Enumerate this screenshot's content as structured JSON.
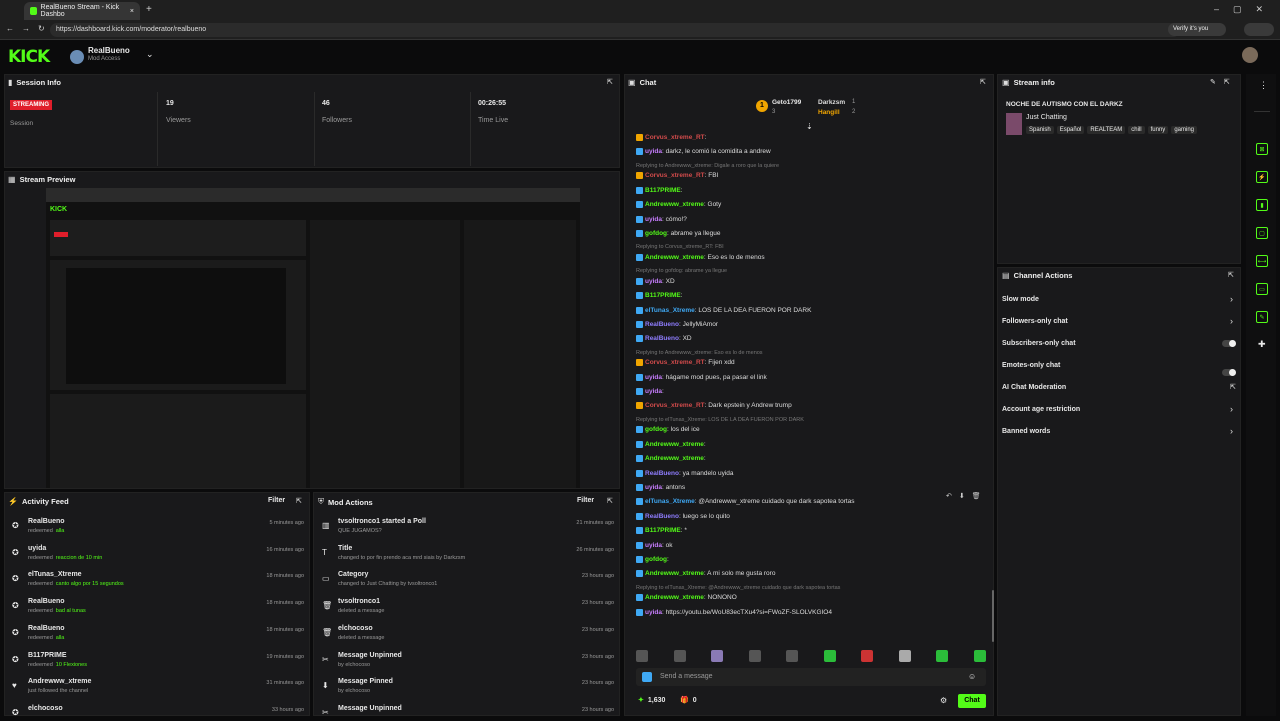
{
  "browser": {
    "tab_title": "RealBueno Stream - Kick Dashbo",
    "url": "https://dashboard.kick.com/moderator/realbueno",
    "verify": "Verify it's you"
  },
  "header": {
    "logo": "KICK",
    "channel": "RealBueno",
    "access": "Mod Access"
  },
  "session": {
    "title": "Session Info",
    "status": "STREAMING",
    "status_label": "Session",
    "viewers": "19",
    "viewers_label": "Viewers",
    "followers": "46",
    "followers_label": "Followers",
    "time": "00:26:55",
    "time_label": "Time Live"
  },
  "preview": {
    "title": "Stream Preview"
  },
  "activity": {
    "title": "Activity Feed",
    "filter": "Filter",
    "items": [
      {
        "user": "RealBueno",
        "action": "redeemed",
        "target": "alla",
        "time": "5 minutes ago"
      },
      {
        "user": "uyida",
        "action": "redeemed",
        "target": "reaccion de 10 min",
        "time": "16 minutes ago"
      },
      {
        "user": "elTunas_Xtreme",
        "action": "redeemed",
        "target": "canto algo por 15 segundos",
        "time": "18 minutes ago"
      },
      {
        "user": "RealBueno",
        "action": "redeemed",
        "target": "bad al tunas",
        "time": "18 minutes ago"
      },
      {
        "user": "RealBueno",
        "action": "redeemed",
        "target": "alla",
        "time": "18 minutes ago"
      },
      {
        "user": "B117PRIME",
        "action": "redeemed",
        "target": "10 Flexiones",
        "time": "19 minutes ago"
      },
      {
        "user": "Andrewww_xtreme",
        "action": "just followed the channel",
        "target": "",
        "time": "31 minutes ago"
      },
      {
        "user": "elchocoso",
        "action": "",
        "target": "",
        "time": "33 hours ago"
      }
    ]
  },
  "mod": {
    "title": "Mod Actions",
    "filter": "Filter",
    "items": [
      {
        "title": "tvsoltronco1 started a Poll",
        "sub": "QUE JUGAMOS?",
        "time": "21 minutes ago",
        "icon": "poll-icon"
      },
      {
        "title": "Title",
        "sub": "changed to por fin prendo aca mrd siais by Darkzsm",
        "time": "26 minutes ago",
        "icon": "title-icon"
      },
      {
        "title": "Category",
        "sub": "changed to Just Chatting by tvsoltronco1",
        "time": "23 hours ago",
        "icon": "category-icon"
      },
      {
        "title": "tvsoltronco1",
        "sub": "deleted a message",
        "time": "23 hours ago",
        "icon": "trash-icon"
      },
      {
        "title": "elchocoso",
        "sub": "deleted a message",
        "time": "23 hours ago",
        "icon": "trash-icon"
      },
      {
        "title": "Message Unpinned",
        "sub": "by elchocoso",
        "time": "23 hours ago",
        "icon": "unpin-icon"
      },
      {
        "title": "Message Pinned",
        "sub": "by elchocoso",
        "time": "23 hours ago",
        "icon": "pin-icon"
      },
      {
        "title": "Message Unpinned",
        "sub": "",
        "time": "23 hours ago",
        "icon": "unpin-icon"
      }
    ]
  },
  "chat": {
    "title": "Chat",
    "top": [
      {
        "name": "Geto1799",
        "count": "3"
      },
      {
        "name": "Darkzsm",
        "count": "1"
      },
      {
        "name": "Hangill",
        "count": "2"
      }
    ],
    "lines": [
      {
        "type": "msg",
        "user": "Corvus_xtreme_RT",
        "color": "#d14b4b",
        "text": ""
      },
      {
        "type": "msg",
        "user": "uyida",
        "color": "#c77dff",
        "text": "darkz, le comió la comidita a andrew"
      },
      {
        "type": "reply",
        "text": "Replying to Andrewww_xtreme: Digale a roro que la quiere"
      },
      {
        "type": "msg",
        "user": "Corvus_xtreme_RT",
        "color": "#d14b4b",
        "text": "FBI"
      },
      {
        "type": "msg",
        "user": "B117PRIME",
        "color": "#53fc18",
        "text": ""
      },
      {
        "type": "msg",
        "user": "Andrewww_xtreme",
        "color": "#53fc18",
        "text": "Goty"
      },
      {
        "type": "msg",
        "user": "uyida",
        "color": "#c77dff",
        "text": "cómo!?"
      },
      {
        "type": "msg",
        "user": "gofdog",
        "color": "#53fc18",
        "text": "abrame ya llegue"
      },
      {
        "type": "reply",
        "text": "Replying to Corvus_xtreme_RT: FBI"
      },
      {
        "type": "msg",
        "user": "Andrewww_xtreme",
        "color": "#53fc18",
        "text": "Eso es lo de menos"
      },
      {
        "type": "reply",
        "text": "Replying to gofdog: abrame ya llegue"
      },
      {
        "type": "msg",
        "user": "uyida",
        "color": "#c77dff",
        "text": "XD"
      },
      {
        "type": "msg",
        "user": "B117PRIME",
        "color": "#53fc18",
        "text": ""
      },
      {
        "type": "msg",
        "user": "elTunas_Xtreme",
        "color": "#3fa9f5",
        "text": "LOS DE LA DEA FUERON POR DARK"
      },
      {
        "type": "msg",
        "user": "RealBueno",
        "color": "#8f7dff",
        "text": "JellyMiAmor"
      },
      {
        "type": "msg",
        "user": "RealBueno",
        "color": "#8f7dff",
        "text": "XD"
      },
      {
        "type": "reply",
        "text": "Replying to Andrewww_xtreme: Eso es lo de menos"
      },
      {
        "type": "msg",
        "user": "Corvus_xtreme_RT",
        "color": "#d14b4b",
        "text": "Fijen xdd"
      },
      {
        "type": "msg",
        "user": "uyida",
        "color": "#c77dff",
        "text": "hágame mod pues, pa pasar el link"
      },
      {
        "type": "msg",
        "user": "uyida",
        "color": "#c77dff",
        "text": ""
      },
      {
        "type": "msg",
        "user": "Corvus_xtreme_RT",
        "color": "#d14b4b",
        "text": "Dark epstein y Andrew trump"
      },
      {
        "type": "reply",
        "text": "Replying to elTunas_Xtreme: LOS DE LA DEA FUERON POR DARK"
      },
      {
        "type": "msg",
        "user": "gofdog",
        "color": "#53fc18",
        "text": "los del ice"
      },
      {
        "type": "msg",
        "user": "Andrewww_xtreme",
        "color": "#53fc18",
        "text": ""
      },
      {
        "type": "msg",
        "user": "Andrewww_xtreme",
        "color": "#53fc18",
        "text": ""
      },
      {
        "type": "msg",
        "user": "RealBueno",
        "color": "#8f7dff",
        "text": "ya mandelo uyida"
      },
      {
        "type": "msg",
        "user": "uyida",
        "color": "#c77dff",
        "text": "antons"
      },
      {
        "type": "msg",
        "user": "elTunas_Xtreme",
        "color": "#3fa9f5",
        "text": "@Andrewww_xtreme cuidado que dark sapotea tortas"
      },
      {
        "type": "msg",
        "user": "RealBueno",
        "color": "#8f7dff",
        "text": "luego se lo quito"
      },
      {
        "type": "msg",
        "user": "B117PRIME",
        "color": "#53fc18",
        "text": "*"
      },
      {
        "type": "msg",
        "user": "uyida",
        "color": "#c77dff",
        "text": "ok"
      },
      {
        "type": "msg",
        "user": "gofdog",
        "color": "#53fc18",
        "text": ""
      },
      {
        "type": "msg",
        "user": "Andrewww_xtreme",
        "color": "#53fc18",
        "text": "A mi solo me gusta roro"
      },
      {
        "type": "reply",
        "text": "Replying to elTunas_Xtreme: @Andrewww_xtreme cuidado que dark sapotea tortas"
      },
      {
        "type": "msg",
        "user": "Andrewww_xtreme",
        "color": "#53fc18",
        "text": "NONONO"
      },
      {
        "type": "msg",
        "user": "uyida",
        "color": "#c77dff",
        "text": "https://youtu.be/WoU83ecTXu4?si=FWoZF-SLOLVKGIO4"
      }
    ],
    "placeholder": "Send a message",
    "points": "1,630",
    "zero": "0",
    "send": "Chat"
  },
  "info": {
    "title": "Stream info",
    "stream_title": "NOCHE DE AUTISMO CON EL DARKZ",
    "category": "Just Chatting",
    "tags": [
      "Spanish",
      "Español",
      "REALTEAM",
      "chill",
      "funny",
      "gaming"
    ]
  },
  "actions": {
    "title": "Channel Actions",
    "items": [
      {
        "label": "Slow mode",
        "ctrl": "chevron"
      },
      {
        "label": "Followers-only chat",
        "ctrl": "chevron"
      },
      {
        "label": "Subscribers-only chat",
        "ctrl": "toggle"
      },
      {
        "label": "Emotes-only chat",
        "ctrl": "toggle"
      },
      {
        "label": "AI Chat Moderation",
        "ctrl": "link"
      },
      {
        "label": "Account age restriction",
        "ctrl": "chevron"
      },
      {
        "label": "Banned words",
        "ctrl": "chevron"
      }
    ]
  }
}
